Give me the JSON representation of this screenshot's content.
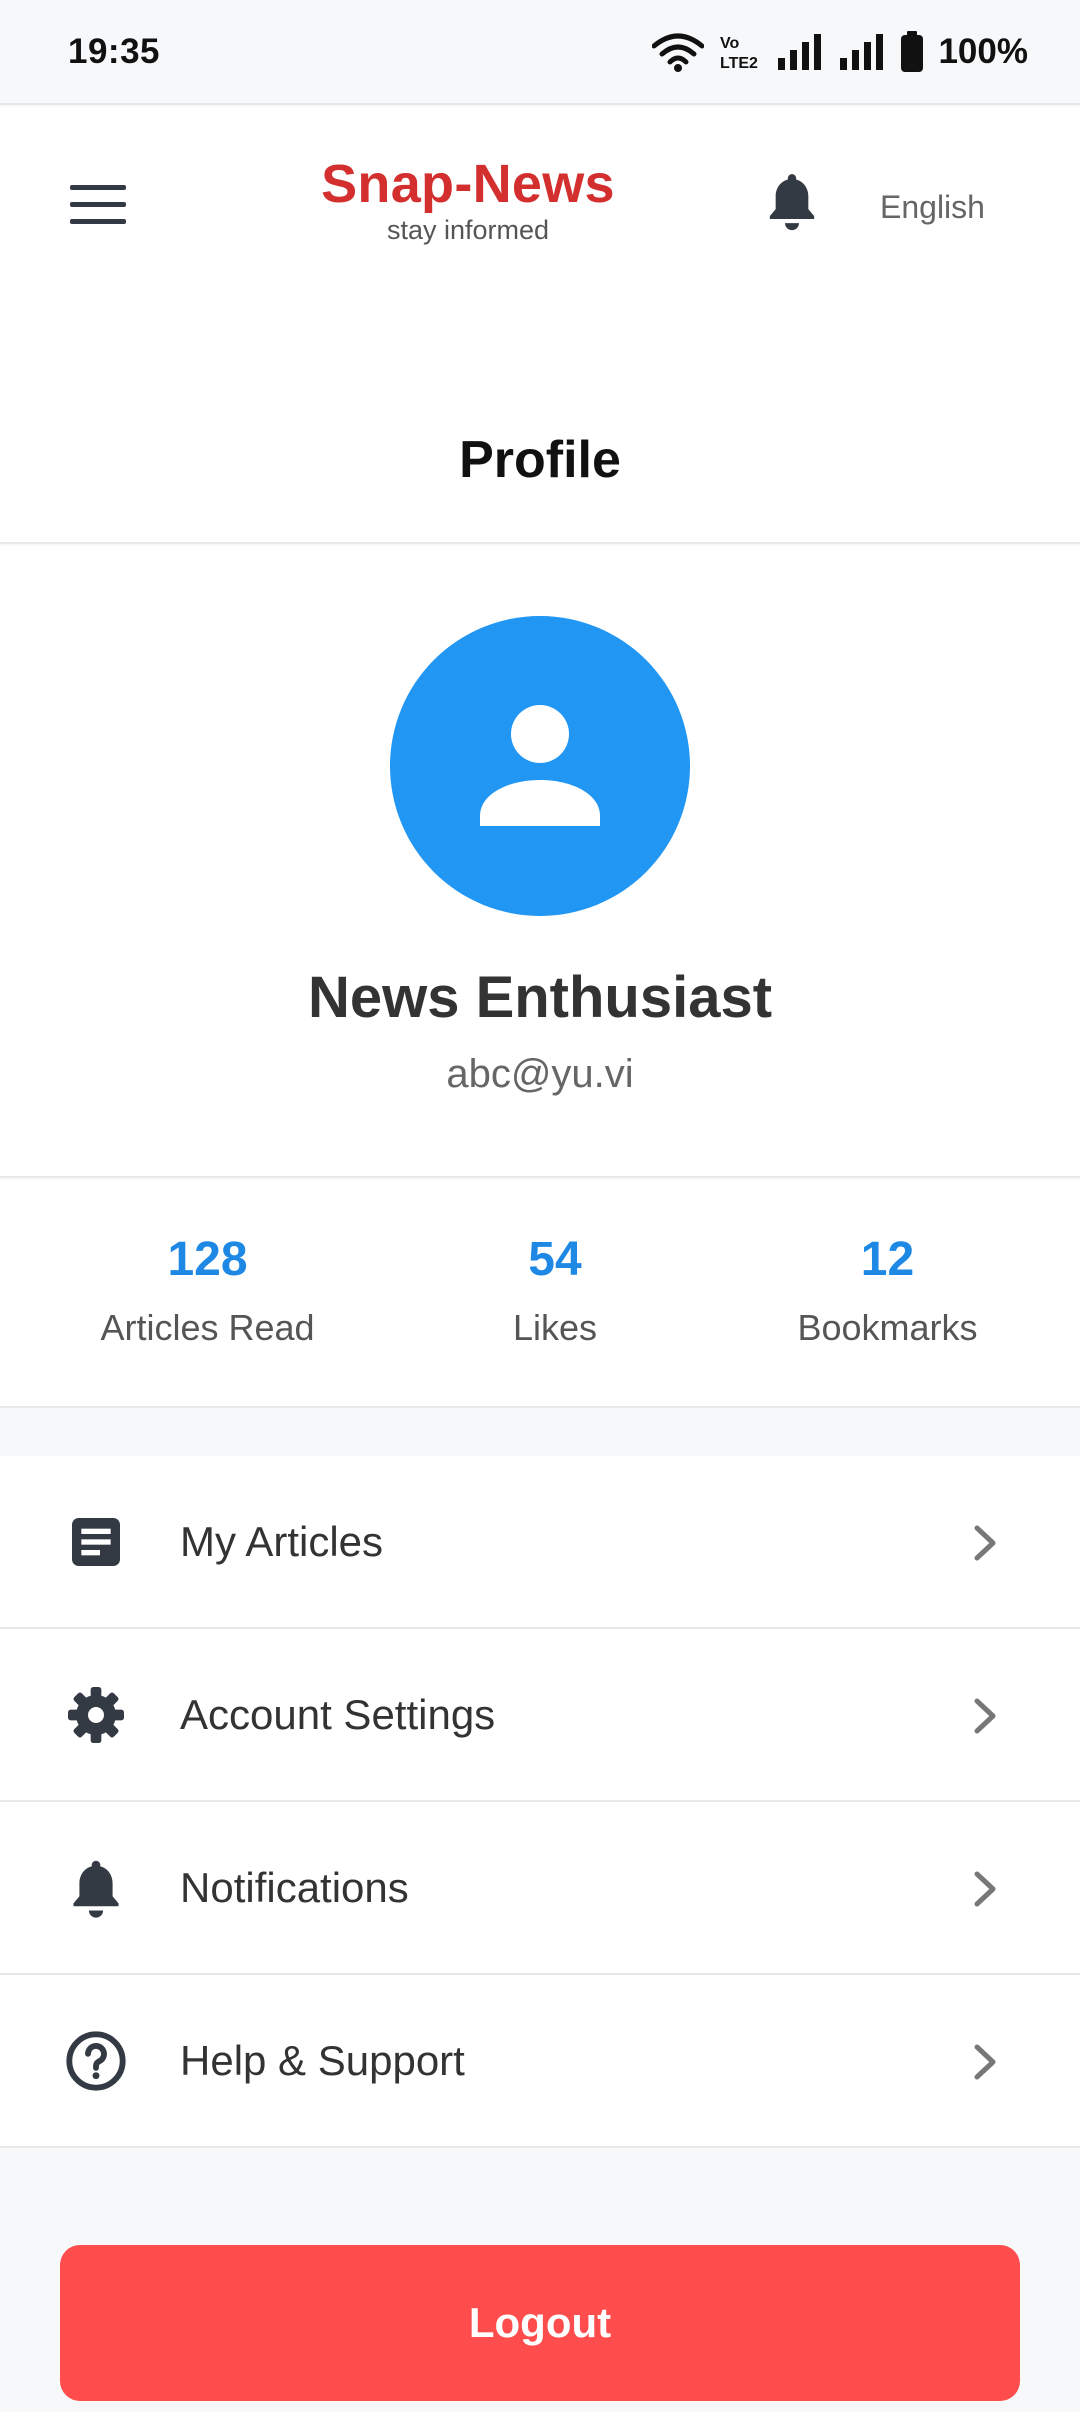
{
  "status_bar": {
    "time": "19:35",
    "volte_label": "Vo LTE2",
    "battery": "100%"
  },
  "header": {
    "brand_title": "Snap-News",
    "brand_subtitle": "stay informed",
    "language": "English",
    "menu_icon": "hamburger-icon",
    "notification_icon": "bell-icon"
  },
  "page": {
    "title": "Profile"
  },
  "profile": {
    "name": "News Enthusiast",
    "email": "abc@yu.vi",
    "avatar_color": "#2196f3"
  },
  "stats": [
    {
      "value": "128",
      "label": "Articles Read"
    },
    {
      "value": "54",
      "label": "Likes"
    },
    {
      "value": "12",
      "label": "Bookmarks"
    }
  ],
  "menu": [
    {
      "label": "My Articles",
      "icon": "article-icon"
    },
    {
      "label": "Account Settings",
      "icon": "gear-icon"
    },
    {
      "label": "Notifications",
      "icon": "bell-icon"
    },
    {
      "label": "Help & Support",
      "icon": "help-icon"
    }
  ],
  "logout": {
    "label": "Logout",
    "color": "#ff4c4c"
  },
  "colors": {
    "brand": "#d32f2f",
    "accent": "#1e88e5"
  }
}
